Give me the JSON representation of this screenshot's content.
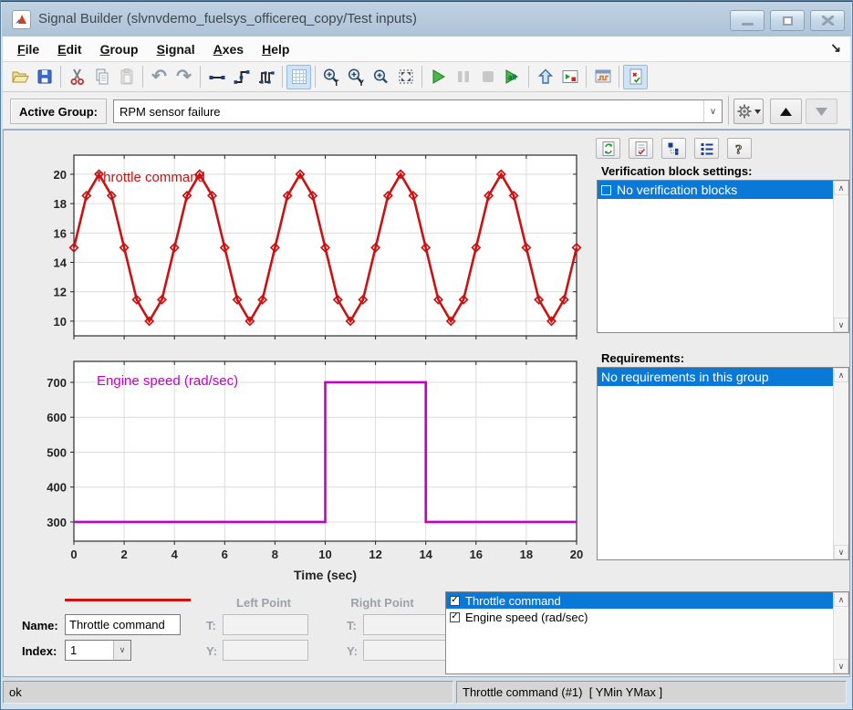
{
  "window": {
    "title": "Signal Builder (slvnvdemo_fuelsys_officereq_copy/Test inputs)",
    "controls": [
      "minimize",
      "maximize",
      "close"
    ]
  },
  "menu": {
    "items": [
      "File",
      "Edit",
      "Group",
      "Signal",
      "Axes",
      "Help"
    ]
  },
  "toolbar": {
    "buttons": [
      {
        "name": "open",
        "enabled": true
      },
      {
        "name": "save",
        "enabled": true
      },
      {
        "name": "cut",
        "enabled": true
      },
      {
        "name": "copy",
        "enabled": true
      },
      {
        "name": "paste",
        "enabled": false
      },
      {
        "name": "undo",
        "enabled": true
      },
      {
        "name": "redo",
        "enabled": true
      },
      {
        "name": "constant-segment",
        "enabled": true
      },
      {
        "name": "step-segment",
        "enabled": true
      },
      {
        "name": "pulse-segment",
        "enabled": true
      },
      {
        "name": "grid-toggle",
        "enabled": true,
        "active": true
      },
      {
        "name": "zoom-in-time",
        "enabled": true
      },
      {
        "name": "zoom-in-y",
        "enabled": true
      },
      {
        "name": "zoom-in-xy",
        "enabled": true
      },
      {
        "name": "fit-to-view",
        "enabled": true
      },
      {
        "name": "start-simulation",
        "enabled": true
      },
      {
        "name": "pause-simulation",
        "enabled": false
      },
      {
        "name": "stop-simulation",
        "enabled": false
      },
      {
        "name": "run-all",
        "enabled": true
      },
      {
        "name": "up-to-parent",
        "enabled": true
      },
      {
        "name": "goto-model",
        "enabled": true
      },
      {
        "name": "signal-scope",
        "enabled": true
      },
      {
        "name": "verification-settings",
        "enabled": true,
        "active": true
      }
    ]
  },
  "group_bar": {
    "label": "Active Group:",
    "value": "RPM sensor failure"
  },
  "sidebar": {
    "verification": {
      "header": "Verification block settings:",
      "items": [
        {
          "checked": false,
          "label": "No verification blocks",
          "selected": true
        }
      ]
    },
    "requirements": {
      "header": "Requirements:",
      "items": [
        {
          "label": "No requirements in this group",
          "selected": true
        }
      ]
    }
  },
  "editor": {
    "name_label": "Name:",
    "name_value": "Throttle command",
    "index_label": "Index:",
    "index_value": "1",
    "left_point_header": "Left Point",
    "right_point_header": "Right Point",
    "t_label": "T:",
    "y_label": "Y:",
    "left_t_value": "",
    "left_y_value": "",
    "right_t_value": "",
    "right_y_value": ""
  },
  "signal_list": {
    "items": [
      {
        "checked": true,
        "label": "Throttle command",
        "selected": true
      },
      {
        "checked": true,
        "label": "Engine speed (rad/sec)",
        "selected": false
      }
    ]
  },
  "status_bar": {
    "left": "ok",
    "right": "Throttle command (#1)  [ YMin YMax ]"
  },
  "colors": {
    "throttle": "#cc1111",
    "engine": "#c400c4",
    "selection": "#0a78d7",
    "grid_line": "#dcdcdc",
    "axis": "#242424"
  },
  "chart_data": [
    {
      "type": "line",
      "title": "Throttle command",
      "color": "#cc1111",
      "marker": "diamond",
      "x": [
        0,
        0.5,
        1,
        1.5,
        2,
        2.5,
        3,
        3.5,
        4,
        4.5,
        5,
        5.5,
        6,
        6.5,
        7,
        7.5,
        8,
        8.5,
        9,
        9.5,
        10,
        10.5,
        11,
        11.5,
        12,
        12.5,
        13,
        13.5,
        14,
        14.5,
        15,
        15.5,
        16,
        16.5,
        17,
        17.5,
        18,
        18.5,
        19,
        19.5,
        20
      ],
      "y": [
        15,
        18.54,
        20,
        18.54,
        15,
        11.46,
        10,
        11.46,
        15,
        18.54,
        20,
        18.54,
        15,
        11.46,
        10,
        11.46,
        15,
        18.54,
        20,
        18.54,
        15,
        11.46,
        10,
        11.46,
        15,
        18.54,
        20,
        18.54,
        15,
        11.46,
        10,
        11.46,
        15,
        18.54,
        20,
        18.54,
        15,
        11.46,
        10,
        11.46,
        15
      ],
      "xlim": [
        0,
        20
      ],
      "ylim": [
        9,
        21.3
      ],
      "xticks": [
        0,
        2,
        4,
        6,
        8,
        10,
        12,
        14,
        16,
        18,
        20
      ],
      "yticks": [
        10,
        12,
        14,
        16,
        18,
        20
      ],
      "show_xtick_labels": false,
      "xlabel": "",
      "grid": true
    },
    {
      "type": "step",
      "title": "Engine speed (rad/sec)",
      "color": "#c400c4",
      "marker": "none",
      "x": [
        0,
        10,
        10,
        14,
        14,
        20
      ],
      "y": [
        300,
        300,
        700,
        700,
        300,
        300
      ],
      "xlim": [
        0,
        20
      ],
      "ylim": [
        245,
        760
      ],
      "xticks": [
        0,
        2,
        4,
        6,
        8,
        10,
        12,
        14,
        16,
        18,
        20
      ],
      "yticks": [
        300,
        400,
        500,
        600,
        700
      ],
      "show_xtick_labels": true,
      "xlabel": "Time (sec)",
      "grid": true
    }
  ]
}
